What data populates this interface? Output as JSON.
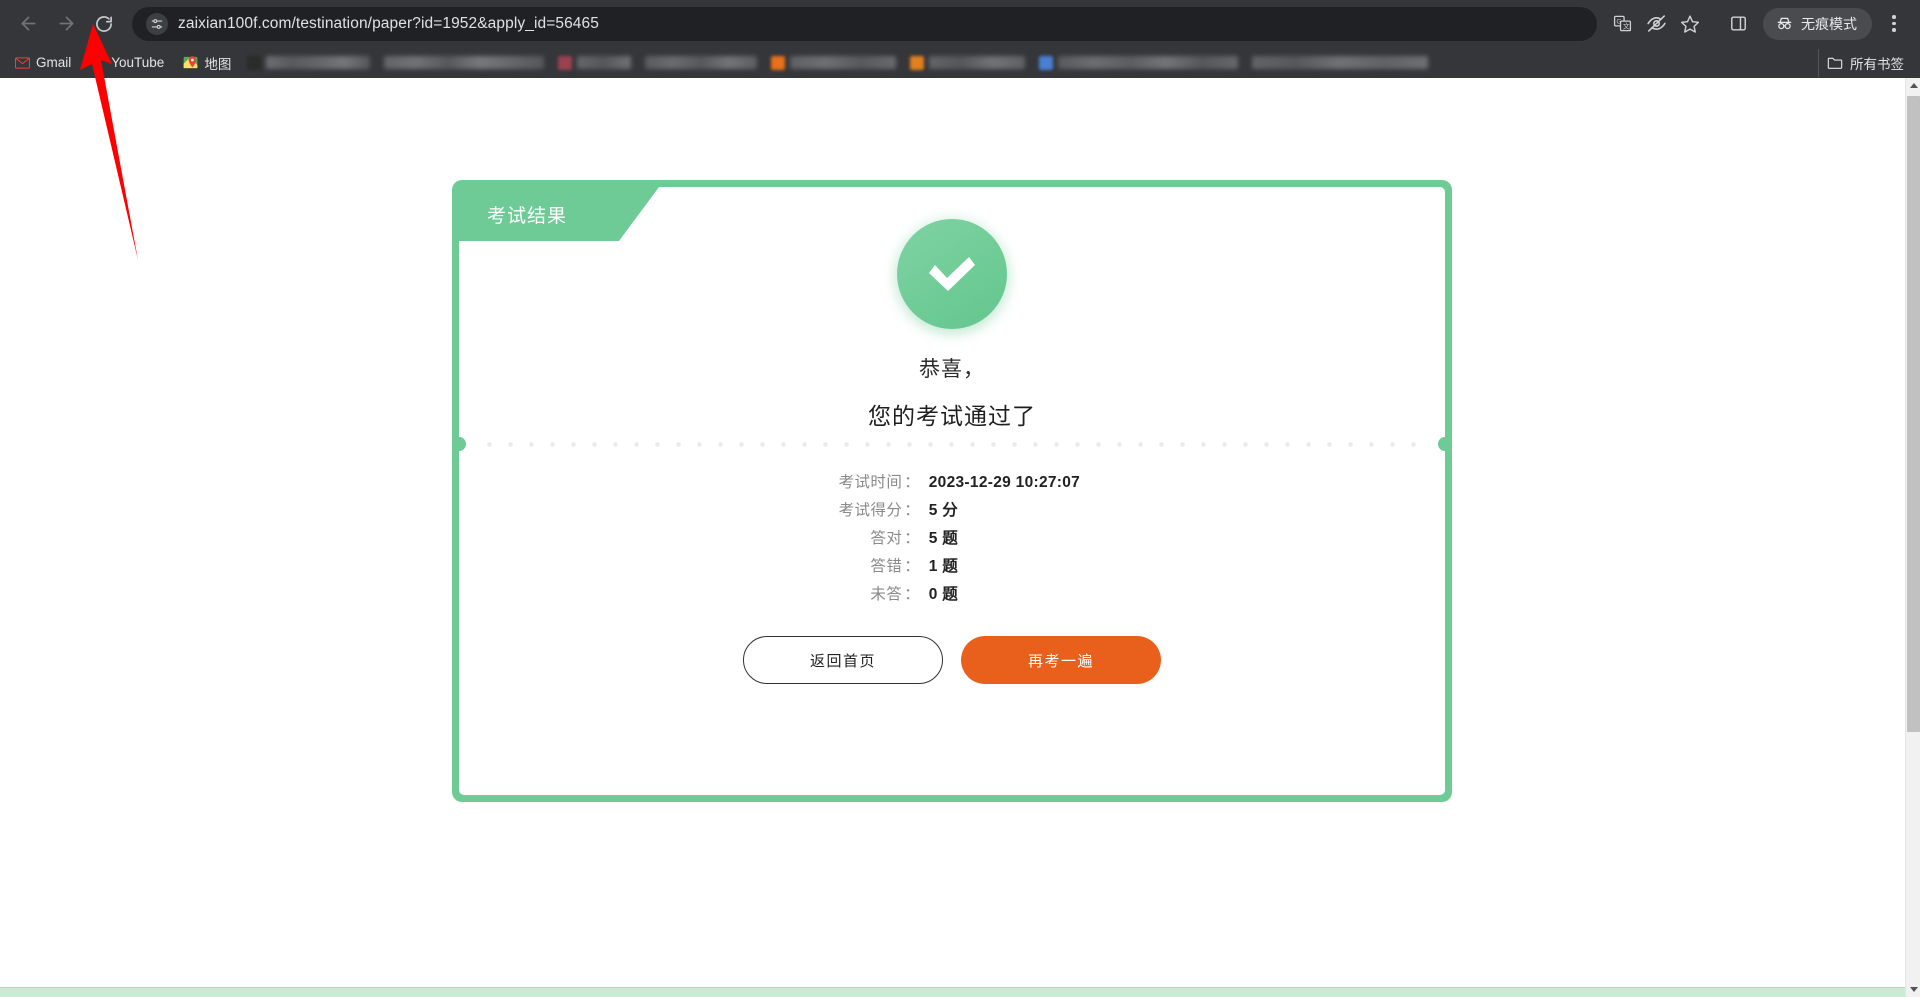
{
  "browser": {
    "back_label": "Back",
    "forward_label": "Forward",
    "reload_label": "Reload",
    "url": "zaixian100f.com/testination/paper?id=1952&apply_id=56465",
    "site_settings_icon": "tune-icon",
    "toolbar_icons": [
      {
        "name": "translate-icon",
        "label": "Translate"
      },
      {
        "name": "eye-off-icon",
        "label": "Hidden"
      },
      {
        "name": "star-icon",
        "label": "Bookmark"
      },
      {
        "name": "side-panel-icon",
        "label": "Side panel"
      }
    ],
    "incognito_label": "无痕模式",
    "menu_label": "Customize and control Chrome"
  },
  "bookmarks": {
    "items": [
      {
        "label": "Gmail",
        "icon": "gmail-icon"
      },
      {
        "label": "YouTube",
        "icon": "youtube-icon"
      },
      {
        "label": "地图",
        "icon": "maps-icon"
      }
    ],
    "redacted_count": 7,
    "all_bookmarks_label": "所有书签",
    "all_bookmarks_icon": "folder-icon"
  },
  "card": {
    "tab_title": "考试结果",
    "status_icon": "check-circle-icon",
    "congrats_line1": "恭喜，",
    "congrats_line2": "您的考试通过了",
    "stats": [
      {
        "label": "考试时间",
        "value": "2023-12-29 10:27:07"
      },
      {
        "label": "考试得分",
        "value": "5 分"
      },
      {
        "label": "答对",
        "value": "5 题"
      },
      {
        "label": "答错",
        "value": "1 题"
      },
      {
        "label": "未答",
        "value": "0 题"
      }
    ],
    "buttons": {
      "home": "返回首页",
      "retake": "再考一遍"
    },
    "colors": {
      "frame_green": "#6ECB96",
      "accent_orange": "#E8601C",
      "bottom_bar": "#c8ecd4"
    }
  },
  "annotation": {
    "arrow_color": "#FF0000",
    "points_at": "reload-button"
  }
}
